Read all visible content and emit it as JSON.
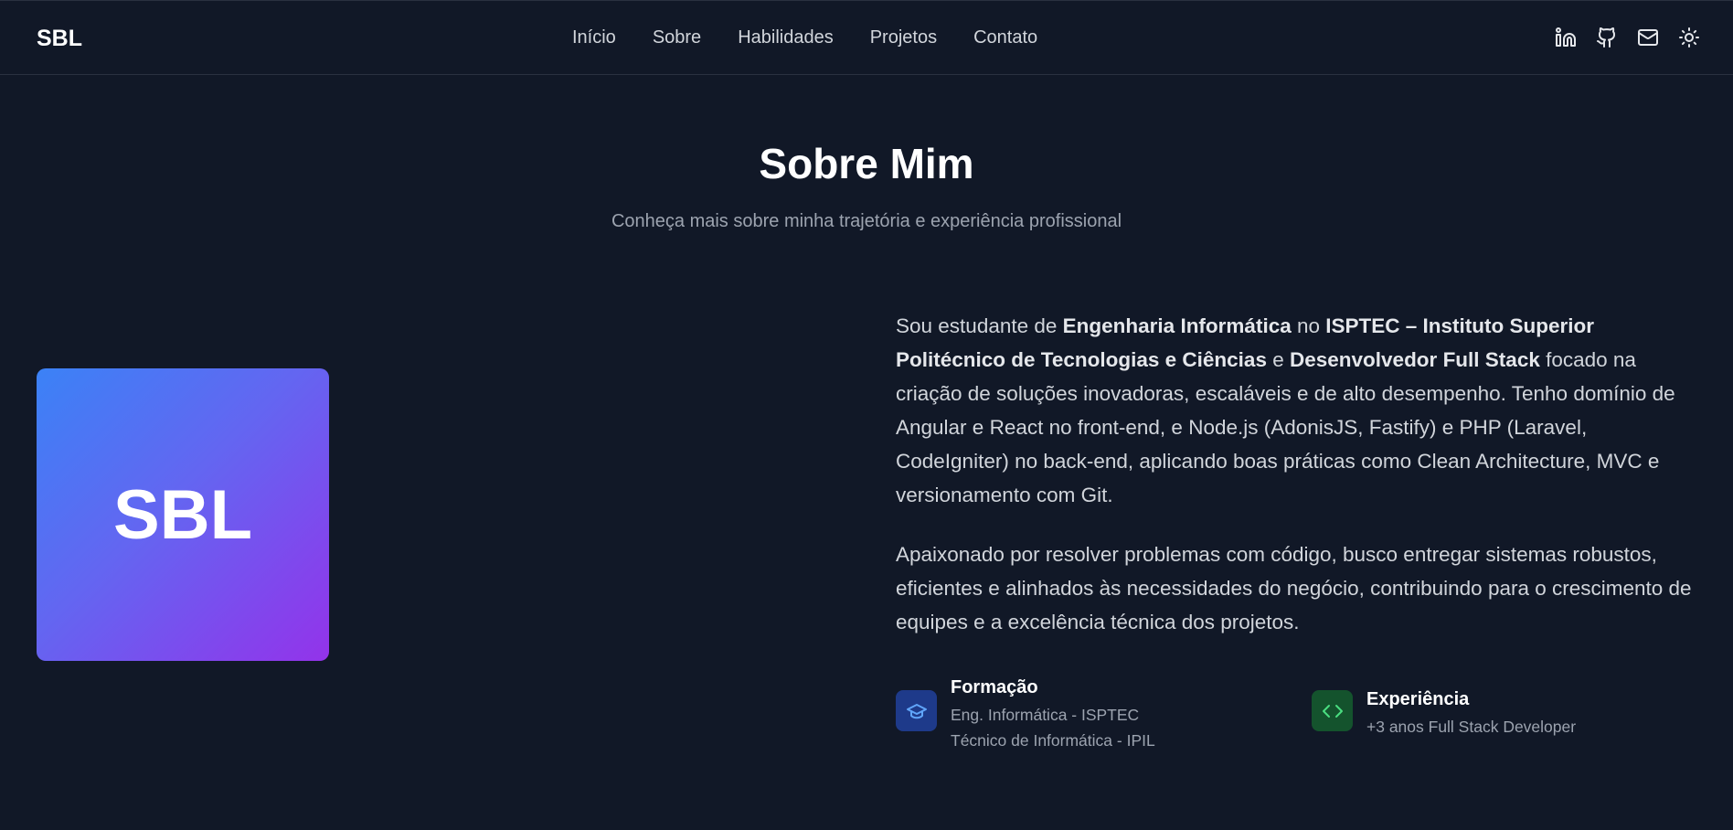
{
  "nav": {
    "brand": "SBL",
    "links": [
      "Início",
      "Sobre",
      "Habilidades",
      "Projetos",
      "Contato"
    ],
    "icons": [
      "linkedin-icon",
      "github-icon",
      "mail-icon",
      "sun-icon"
    ]
  },
  "about": {
    "title": "Sobre Mim",
    "subtitle": "Conheça mais sobre minha trajetória e experiência profissional",
    "avatar_text": "SBL",
    "p1": {
      "t1": "Sou estudante de ",
      "b1": "Engenharia Informática",
      "t2": " no ",
      "b2": "ISPTEC – Instituto Superior Politécnico de Tecnologias e Ciências",
      "t3": " e ",
      "b3": "Desenvolvedor Full Stack",
      "t4": " focado na criação de soluções inovadoras, escaláveis e de alto desempenho. Tenho domínio de Angular e React no front-end, e Node.js (AdonisJS, Fastify) e PHP (Laravel, CodeIgniter) no back-end, aplicando boas práticas como Clean Architecture, MVC e versionamento com Git."
    },
    "p2": "Apaixonado por resolver problemas com código, busco entregar sistemas robustos, eficientes e alinhados às necessidades do negócio, contribuindo para o crescimento de equipes e a excelência técnica dos projetos.",
    "formacao": {
      "title": "Formação",
      "lines": [
        "Eng. Informática - ISPTEC",
        "Técnico de Informática - IPIL"
      ],
      "icon": "graduation-cap-icon",
      "color": "#60a5fa"
    },
    "experiencia": {
      "title": "Experiência",
      "lines": [
        "+3 anos Full Stack Developer"
      ],
      "icon": "code-icon",
      "color": "#4ade80"
    }
  },
  "colors": {
    "background": "#111827",
    "accent_from": "#3b82f6",
    "accent_to": "#9333ea"
  }
}
